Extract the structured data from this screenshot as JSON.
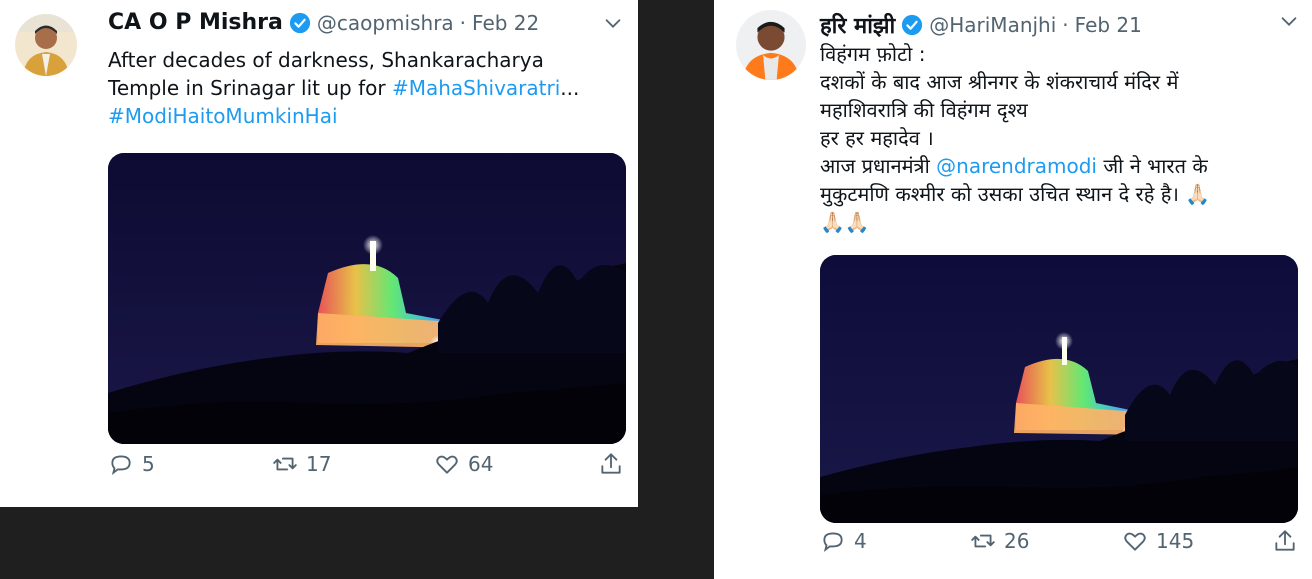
{
  "tweets": [
    {
      "display_name": "CA O P Mishra",
      "handle": "@caopmishra",
      "separator": "·",
      "date": "Feb 22",
      "text_parts": {
        "l1": "After decades of darkness, Shankaracharya",
        "l2_plain": "Temple in Srinagar lit up for ",
        "l2_link": "#MahaShivaratri",
        "l2_tail": "...",
        "l3_link": "#ModiHaitoMumkinHai"
      },
      "replies": "5",
      "retweets": "17",
      "likes": "64"
    },
    {
      "display_name": "हरि मांझी",
      "handle": "@HariManjhi",
      "separator": "·",
      "date": "Feb 21",
      "text_parts": {
        "l1": "विहंगम फ़ोटो :",
        "l2": "दशकों के बाद आज श्रीनगर के शंकराचार्य मंदिर में",
        "l3": "महाशिवरात्रि की विहंगम दृश्य",
        "l4": "हर हर महादेव ।",
        "l5_plain": "आज प्रधानमंत्री ",
        "l5_link": "@narendramodi",
        "l5_tail": " जी ने भारत के",
        "l6": "मुकुटमणि कश्मीर को उसका उचित स्थान दे रहे है। 🙏🏻",
        "l7": "🙏🏻🙏🏻"
      },
      "replies": "4",
      "retweets": "26",
      "likes": "145"
    }
  ],
  "icons": {
    "verified": "verified-badge-icon",
    "more": "chevron-down-icon",
    "reply": "reply-icon",
    "retweet": "retweet-icon",
    "like": "heart-icon",
    "share": "share-icon"
  },
  "colors": {
    "link": "#1d9bf0",
    "verified": "#1d9bf0",
    "muted": "#536471",
    "background": "#1f1f1f"
  }
}
